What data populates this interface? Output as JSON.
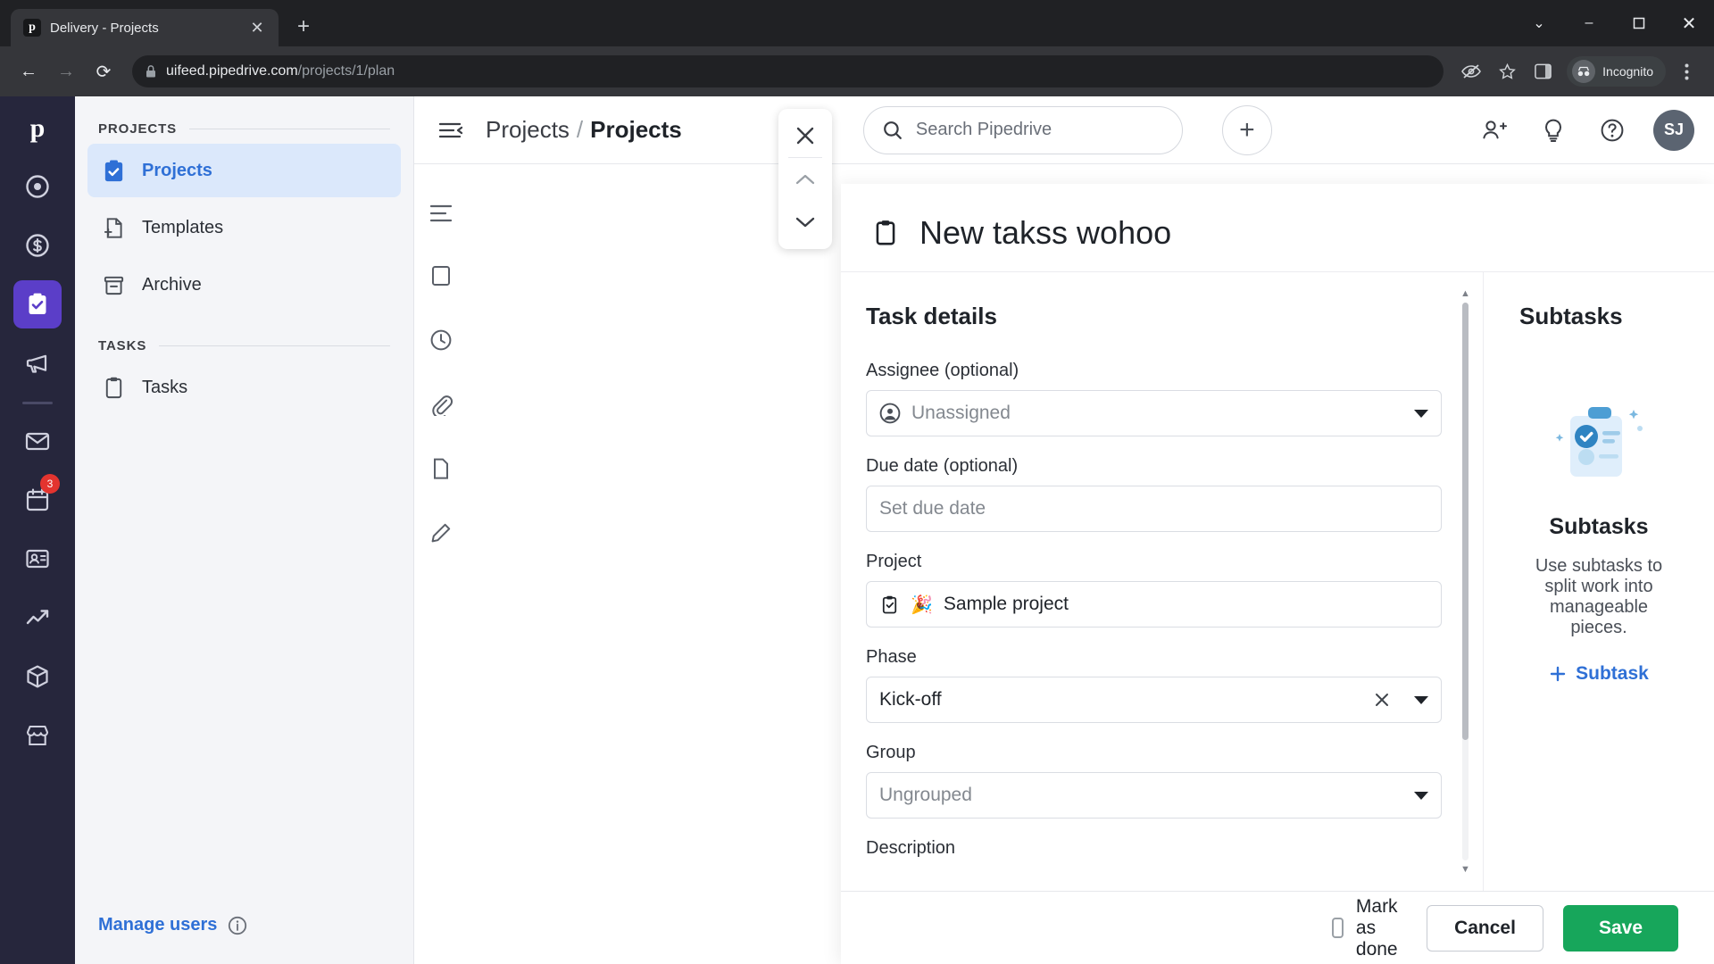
{
  "browser": {
    "tab": {
      "title": "Delivery - Projects",
      "favicon_letter": "p",
      "close_icon": "close-icon"
    },
    "new_tab_label": "+",
    "window": {
      "minimize": "–",
      "maximize": "❐",
      "close": "✕",
      "collapse": "⌄"
    },
    "nav": {
      "back": "←",
      "forward": "→",
      "reload": "⟳"
    },
    "url": {
      "domain": "uifeed.pipedrive.com",
      "path": "/projects/1/plan",
      "lock_icon": "lock-icon"
    },
    "toolbar_icons": [
      "tracking-protection-icon",
      "bookmark-star-icon",
      "side-panel-icon",
      "browser-menu-icon"
    ],
    "profile": {
      "label": "Incognito",
      "icon": "incognito-icon"
    }
  },
  "rail": {
    "logo": "p",
    "items": [
      {
        "name": "rail-item-leads",
        "icon": "target-icon"
      },
      {
        "name": "rail-item-deals",
        "icon": "dollar-icon"
      },
      {
        "name": "rail-item-projects",
        "icon": "projects-check-icon",
        "active": true
      },
      {
        "name": "rail-item-campaigns",
        "icon": "megaphone-icon"
      },
      {
        "name": "rail-item-mail",
        "icon": "mail-icon"
      },
      {
        "name": "rail-item-activities",
        "icon": "calendar-icon",
        "badge": "3"
      },
      {
        "name": "rail-item-contacts",
        "icon": "contacts-icon"
      },
      {
        "name": "rail-item-insights",
        "icon": "insights-chart-icon"
      },
      {
        "name": "rail-item-products",
        "icon": "box-icon"
      },
      {
        "name": "rail-item-marketplace",
        "icon": "marketplace-icon"
      }
    ]
  },
  "sidebar": {
    "sections": [
      {
        "label": "PROJECTS",
        "items": [
          {
            "label": "Projects",
            "icon": "clipboard-check-icon",
            "active": true
          },
          {
            "label": "Templates",
            "icon": "file-plus-icon",
            "active": false
          },
          {
            "label": "Archive",
            "icon": "archive-box-icon",
            "active": false
          }
        ]
      },
      {
        "label": "TASKS",
        "items": [
          {
            "label": "Tasks",
            "icon": "clipboard-icon",
            "active": false
          }
        ]
      }
    ],
    "footer": {
      "label": "Manage users",
      "info_icon": "info-circle-icon"
    }
  },
  "appbar": {
    "menu_icon": "hamburger-collapse-icon",
    "breadcrumb_root": "Projects",
    "breadcrumb_sep": "/",
    "breadcrumb_current": "Projects",
    "search_placeholder": "Search Pipedrive",
    "search_icon": "search-icon",
    "add_button": "+",
    "icons": [
      "invite-user-icon",
      "whats-new-bulb-icon",
      "help-question-icon"
    ],
    "avatar_initials": "SJ"
  },
  "nav_cluster": {
    "close_icon": "close-icon",
    "prev_icon": "chevron-up-icon",
    "next_icon": "chevron-down-icon"
  },
  "modal": {
    "title": "New takss wohoo",
    "title_icon": "clipboard-icon",
    "details": {
      "heading": "Task details",
      "fields": [
        {
          "label": "Assignee (optional)",
          "name": "assignee",
          "placeholder": "Unassigned",
          "value": "",
          "icon": "person-circle-icon",
          "control": "select"
        },
        {
          "label": "Due date (optional)",
          "name": "due-date",
          "placeholder": "Set due date",
          "value": "",
          "control": "text"
        },
        {
          "label": "Project",
          "name": "project",
          "value": "Sample project",
          "icon": "clipboard-check-icon",
          "emoji": "🎉",
          "control": "text"
        },
        {
          "label": "Phase",
          "name": "phase",
          "value": "Kick-off",
          "control": "select-clearable",
          "clear_icon": "clear-x-icon"
        },
        {
          "label": "Group",
          "name": "group",
          "placeholder": "Ungrouped",
          "value": "",
          "control": "select"
        },
        {
          "label": "Description",
          "name": "description",
          "value": "",
          "control": "textarea"
        }
      ]
    },
    "subtasks": {
      "heading": "Subtasks",
      "empty_title": "Subtasks",
      "empty_text": "Use subtasks to split work into manageable pieces.",
      "add_label": "Subtask",
      "add_icon": "plus-icon",
      "illustration": "subtasks-clipboard-illustration"
    },
    "footer": {
      "mark_done_label": "Mark as done",
      "cancel_label": "Cancel",
      "save_label": "Save",
      "save_color": "#17a65b"
    },
    "scrollbar": {
      "up_arrow": "▲",
      "down_arrow": "▼"
    }
  }
}
